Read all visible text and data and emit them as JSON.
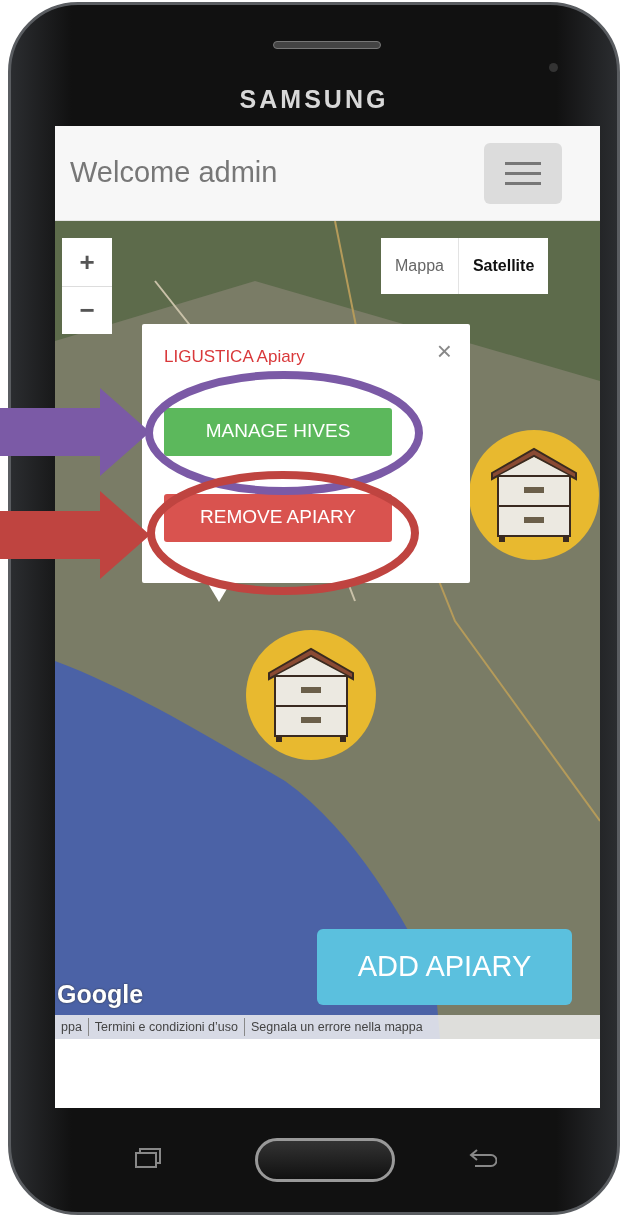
{
  "device": {
    "brand": "SAMSUNG"
  },
  "navbar": {
    "title": "Welcome admin"
  },
  "map": {
    "zoom_controls": [
      "+",
      "−"
    ],
    "map_types": [
      {
        "label": "Mappa",
        "selected": false
      },
      {
        "label": "Satellite",
        "selected": true
      }
    ],
    "popup": {
      "title": "LIGUSTICA Apiary",
      "close": "×",
      "buttons": [
        {
          "label": "MANAGE HIVES",
          "kind": "success"
        },
        {
          "label": "REMOVE APIARY",
          "kind": "danger"
        }
      ]
    },
    "logo": "Google",
    "footer_links": [
      "ppa",
      "Termini e condizioni d’uso",
      "Segnala un errore nella mappa"
    ]
  },
  "add_button": "ADD APIARY",
  "highlights": [
    {
      "color": "#7b5aa6"
    },
    {
      "color": "#bf4440"
    }
  ]
}
